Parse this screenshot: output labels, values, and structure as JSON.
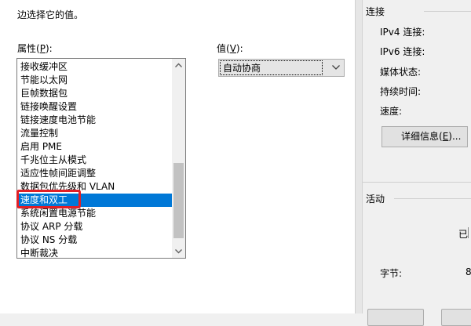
{
  "dialog": {
    "description_line1": "",
    "description_line2": "边选择它的值。",
    "property_label_prefix": "属性(",
    "property_label_key": "P",
    "property_label_suffix": "):",
    "value_label_prefix": "值(",
    "value_label_key": "V",
    "value_label_suffix": "):",
    "properties": [
      "接收缓冲区",
      "节能以太网",
      "巨帧数据包",
      "链接唤醒设置",
      "链接速度电池节能",
      "流量控制",
      "启用 PME",
      "千兆位主从模式",
      "适应性帧间距调整",
      "数据包优先级和 VLAN",
      "速度和双工",
      "系统闲置电源节能",
      "协议 ARP 分载",
      "协议 NS 分载",
      "中断裁决"
    ],
    "selected_property": "速度和双工",
    "value_selected": "自动协商",
    "accent_color": "#0078d7",
    "highlight_color": "#e21f26"
  },
  "status_panel": {
    "connection_heading": "连接",
    "ipv4_label": "IPv4 连接:",
    "ipv6_label": "IPv6 连接:",
    "media_state_label": "媒体状态:",
    "duration_label": "持续时间:",
    "speed_label": "速度:",
    "details_button_prefix": "详细信息(",
    "details_button_key": "E",
    "details_button_suffix": ")...",
    "activity_heading": "活动",
    "sent_partial": "已",
    "bytes_label": "字节:",
    "bytes_value_partial": "8"
  }
}
